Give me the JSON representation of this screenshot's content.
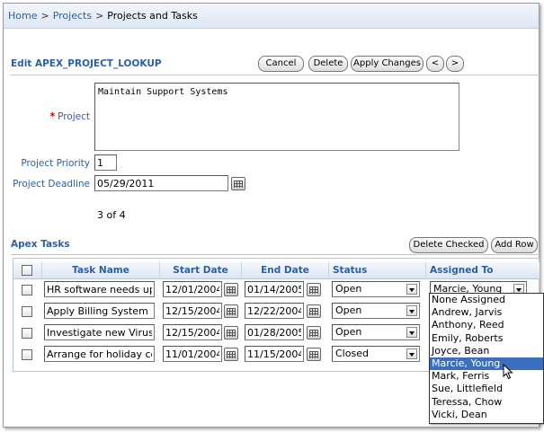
{
  "breadcrumb": {
    "home": "Home",
    "projects": "Projects",
    "current": "Projects and Tasks",
    "separator": ">"
  },
  "edit_region": {
    "title": "Edit APEX_PROJECT_LOOKUP",
    "buttons": {
      "cancel": "Cancel",
      "delete": "Delete",
      "apply": "Apply Changes",
      "prev": "<",
      "next": ">"
    },
    "fields": {
      "project_label": "Project",
      "project_required_marker": "*",
      "project_value": "Maintain Support Systems",
      "priority_label": "Project Priority",
      "priority_value": "1",
      "deadline_label": "Project Deadline",
      "deadline_value": "05/29/2011"
    },
    "counter": "3 of 4"
  },
  "tasks_region": {
    "title": "Apex Tasks",
    "buttons": {
      "delete_checked": "Delete Checked",
      "add_row": "Add Row"
    },
    "columns": {
      "task_name": "Task Name",
      "start_date": "Start Date",
      "end_date": "End Date",
      "status": "Status",
      "assigned_to": "Assigned To"
    },
    "rows": [
      {
        "task": "HR software needs up",
        "start": "12/01/2004",
        "end": "01/14/2005",
        "status": "Open",
        "assigned": "Marcie, Young"
      },
      {
        "task": "Apply Billing System u",
        "start": "12/15/2004",
        "end": "12/22/2004",
        "status": "Open",
        "assigned": ""
      },
      {
        "task": "Investigate new Virus",
        "start": "12/15/2004",
        "end": "01/28/2005",
        "status": "Open",
        "assigned": ""
      },
      {
        "task": "Arrange for holiday co",
        "start": "11/01/2004",
        "end": "11/15/2004",
        "status": "Closed",
        "assigned": ""
      }
    ],
    "assigned_options": [
      "None Assigned",
      "Andrew, Jarvis",
      "Anthony, Reed",
      "Emily, Roberts",
      "Joyce, Bean",
      "Marcie, Young",
      "Mark, Ferris",
      "Sue, Littlefield",
      "Teressa, Chow",
      "Vicki, Dean"
    ],
    "assigned_selected": "Marcie, Young"
  },
  "colors": {
    "link_blue": "#2b5fa8",
    "required_red": "#c00000",
    "selection_blue": "#3a6fc0"
  }
}
